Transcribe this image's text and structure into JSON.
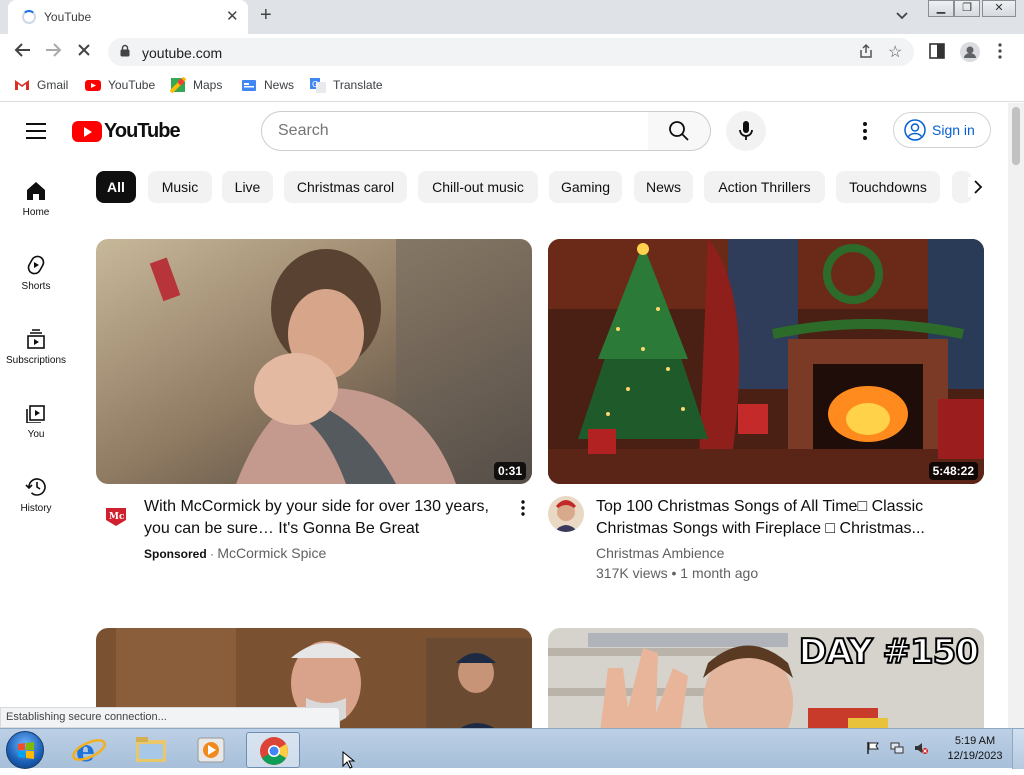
{
  "browser": {
    "tab": {
      "title": "YouTube"
    },
    "address": {
      "url": "youtube.com"
    },
    "bookmarks": [
      {
        "label": "Gmail",
        "icon": "gmail-icon"
      },
      {
        "label": "YouTube",
        "icon": "youtube-icon"
      },
      {
        "label": "Maps",
        "icon": "maps-icon"
      },
      {
        "label": "News",
        "icon": "news-icon"
      },
      {
        "label": "Translate",
        "icon": "translate-icon"
      }
    ],
    "status": "Establishing secure connection..."
  },
  "youtube": {
    "logo_text": "YouTube",
    "search": {
      "placeholder": "Search"
    },
    "signin_label": "Sign in",
    "guide": [
      {
        "label": "Home",
        "icon": "home-icon"
      },
      {
        "label": "Shorts",
        "icon": "shorts-icon"
      },
      {
        "label": "Subscriptions",
        "icon": "subscriptions-icon"
      },
      {
        "label": "You",
        "icon": "you-icon"
      },
      {
        "label": "History",
        "icon": "history-icon"
      }
    ],
    "chips": [
      "All",
      "Music",
      "Live",
      "Christmas carol",
      "Chill-out music",
      "Gaming",
      "News",
      "Action Thrillers",
      "Touchdowns"
    ],
    "active_chip": "All",
    "videos": [
      {
        "title_line1": "With McCormick by your side for over 130 years,",
        "title_line2": "you can be sure… It's Gonna Be Great",
        "sponsored": "Sponsored",
        "channel": "McCormick Spice",
        "duration": "0:31"
      },
      {
        "title_line1": "Top 100 Christmas Songs of All Time□ Classic",
        "title_line2": "Christmas Songs with Fireplace □ Christmas...",
        "channel": "Christmas Ambience",
        "stats": "317K views • 1 month ago",
        "duration": "5:48:22"
      },
      {
        "overlay_text": ""
      },
      {
        "overlay_text": "DAY #150"
      }
    ]
  },
  "taskbar": {
    "time": "5:19 AM",
    "date": "12/19/2023"
  },
  "colors": {
    "youtube_red": "#ff0000",
    "link_blue": "#065fd4",
    "chrome_blue": "#1a73e8"
  }
}
